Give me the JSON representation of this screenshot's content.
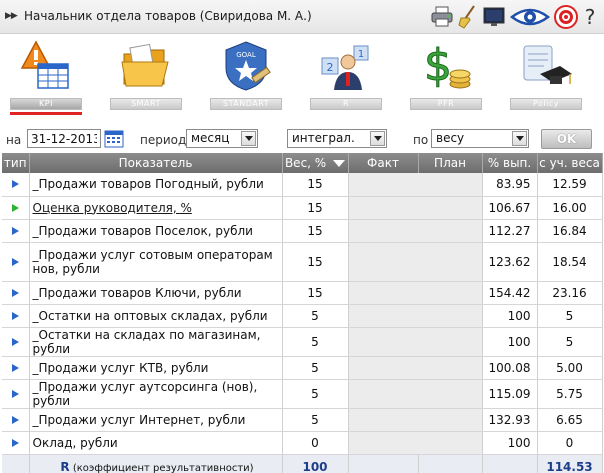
{
  "header": {
    "title": "Начальник отдела товаров  (Свиридова М. А.)",
    "help_glyph": "?"
  },
  "nav": {
    "items": [
      {
        "label": "KPI",
        "icon": "kpi-warning-table-icon",
        "active": true
      },
      {
        "label": "SMART",
        "icon": "folder-icon",
        "active": false
      },
      {
        "label": "STANDART",
        "icon": "goal-star-icon",
        "active": false
      },
      {
        "label": "R",
        "icon": "user-rank-icon",
        "active": false
      },
      {
        "label": "PFR",
        "icon": "money-coins-icon",
        "active": false
      },
      {
        "label": "Policy",
        "icon": "diploma-cap-icon",
        "active": false
      }
    ]
  },
  "filter": {
    "na_label": "на",
    "date": "31-12-2013",
    "period_label": "период",
    "period_value": "месяц",
    "mode_value": "интеграл.",
    "po_label": "по",
    "sort_value": "весу",
    "ok_label": "OK"
  },
  "table": {
    "headers": {
      "tip": "тип",
      "name": "Показатель",
      "weight": "Вес, %",
      "fact": "Факт",
      "plan": "План",
      "pct": "% вып.",
      "weighted": "с уч. веса"
    },
    "rows": [
      {
        "tip": "blue",
        "name": "_Продажи товаров Погодный, рубли",
        "weight": "15",
        "pct": "83.95",
        "weighted": "12.59"
      },
      {
        "tip": "green",
        "name": "Оценка руководителя, %",
        "weight": "15",
        "pct": "106.67",
        "weighted": "16.00",
        "link": true
      },
      {
        "tip": "blue",
        "name": "_Продажи товаров Поселок, рубли",
        "weight": "15",
        "pct": "112.27",
        "weighted": "16.84"
      },
      {
        "tip": "blue",
        "name": "_Продажи услуг сотовым операторам нов, рубли",
        "weight": "15",
        "pct": "123.62",
        "weighted": "18.54",
        "tall": true
      },
      {
        "tip": "blue",
        "name": "_Продажи товаров Ключи, рубли",
        "weight": "15",
        "pct": "154.42",
        "weighted": "23.16"
      },
      {
        "tip": "blue",
        "name": "_Остатки на оптовых складах, рубли",
        "weight": "5",
        "pct": "100",
        "weighted": "5"
      },
      {
        "tip": "blue",
        "name": "_Остатки на складах по магазинам, рубли",
        "weight": "5",
        "pct": "100",
        "weighted": "5"
      },
      {
        "tip": "blue",
        "name": "_Продажи услуг КТВ, рубли",
        "weight": "5",
        "pct": "100.08",
        "weighted": "5.00"
      },
      {
        "tip": "blue",
        "name": "_Продажи услуг аутсорсинга (нов), рубли",
        "weight": "5",
        "pct": "115.09",
        "weighted": "5.75"
      },
      {
        "tip": "blue",
        "name": "_Продажи услуг Интернет, рубли",
        "weight": "5",
        "pct": "132.93",
        "weighted": "6.65"
      },
      {
        "tip": "blue",
        "name": "Оклад, рубли",
        "weight": "0",
        "pct": "100",
        "weighted": "0"
      }
    ],
    "footer": {
      "r": "R",
      "r_desc": "(коэффициент результативности)",
      "weight_total": "100",
      "weighted_total": "114.53"
    }
  },
  "colors": {
    "accent_blue": "#2a67c9",
    "accent_green": "#2fb02f",
    "active_underline": "#e02424",
    "header_gray": "#7a7a7a"
  }
}
